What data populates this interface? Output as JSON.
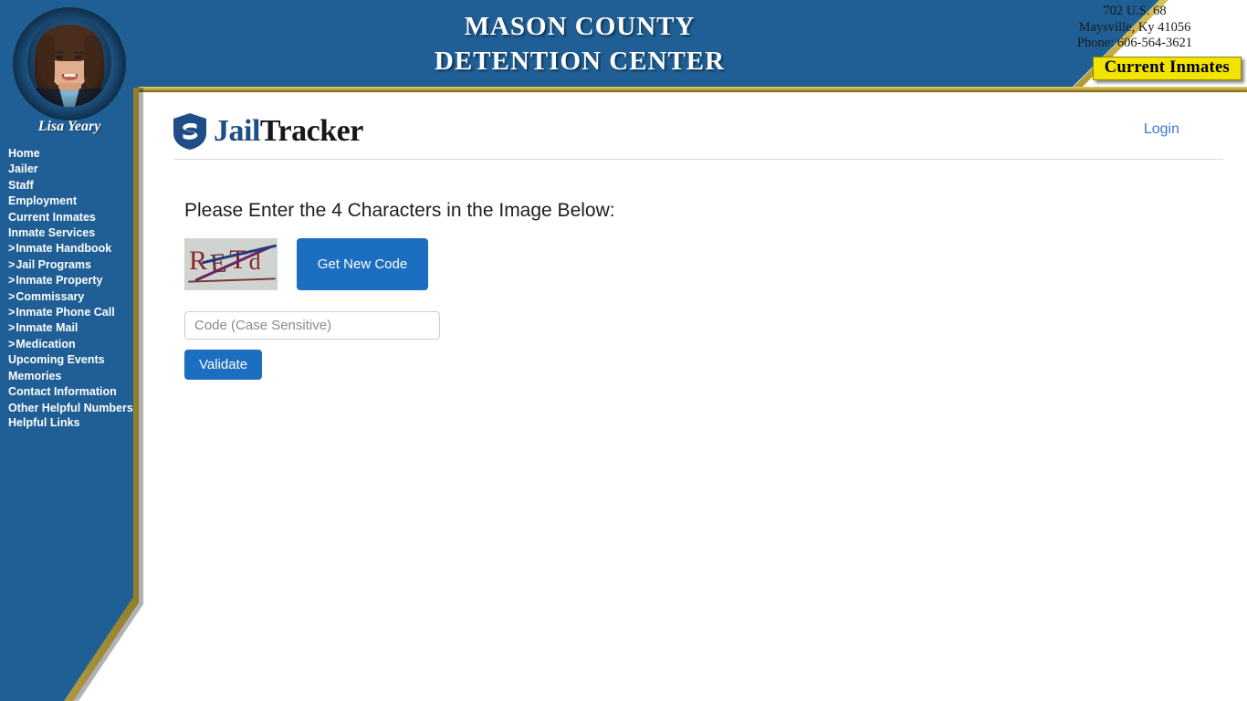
{
  "header": {
    "title_line1": "MASON COUNTY",
    "title_line2": "DETENTION CENTER",
    "address_line1": "702 U.S. 68",
    "address_line2": "Maysville, Ky 41056",
    "address_line3": "Phone: 606-564-3621",
    "current_inmates_badge": "Current Inmates",
    "banner_color": "#1f5f95",
    "gold_color": "#b39a33",
    "badge_color": "#f2e400"
  },
  "sidebar": {
    "officer_name": "Lisa Yeary",
    "items": [
      {
        "label": "Home",
        "sub": false
      },
      {
        "label": "Jailer",
        "sub": false
      },
      {
        "label": "Staff",
        "sub": false
      },
      {
        "label": "Employment",
        "sub": false
      },
      {
        "label": "Current Inmates",
        "sub": false
      },
      {
        "label": "Inmate Services",
        "sub": false
      },
      {
        "label": "Inmate Handbook",
        "sub": true
      },
      {
        "label": "Jail Programs",
        "sub": true
      },
      {
        "label": "Inmate Property",
        "sub": true
      },
      {
        "label": "Commissary",
        "sub": true
      },
      {
        "label": "Inmate Phone Call",
        "sub": true
      },
      {
        "label": "Inmate Mail",
        "sub": true
      },
      {
        "label": "Medication",
        "sub": true
      },
      {
        "label": "Upcoming Events",
        "sub": false
      },
      {
        "label": "Memories",
        "sub": false
      },
      {
        "label": "Contact Information",
        "sub": false
      },
      {
        "label": "Other Helpful Numbers",
        "sub": false,
        "wrap": true
      },
      {
        "label": "Helpful Links",
        "sub": false
      }
    ],
    "sub_arrow": ">"
  },
  "topbar": {
    "logo_jail": "Jail",
    "logo_tracker": "Tracker",
    "logo_icon": "shield-icon",
    "login_label": "Login",
    "login_color": "#3a7ad4"
  },
  "main": {
    "captcha_heading": "Please Enter the 4 Characters in the Image Below:",
    "captcha_text": "RETd",
    "captcha_char_1": "R",
    "captcha_char_2": "E",
    "captcha_char_3": "T",
    "captcha_char_4": "d",
    "get_new_code_label": "Get New Code",
    "code_input_value": "",
    "code_input_placeholder": "Code (Case Sensitive)",
    "validate_label": "Validate",
    "button_color": "#1c6ec0"
  }
}
